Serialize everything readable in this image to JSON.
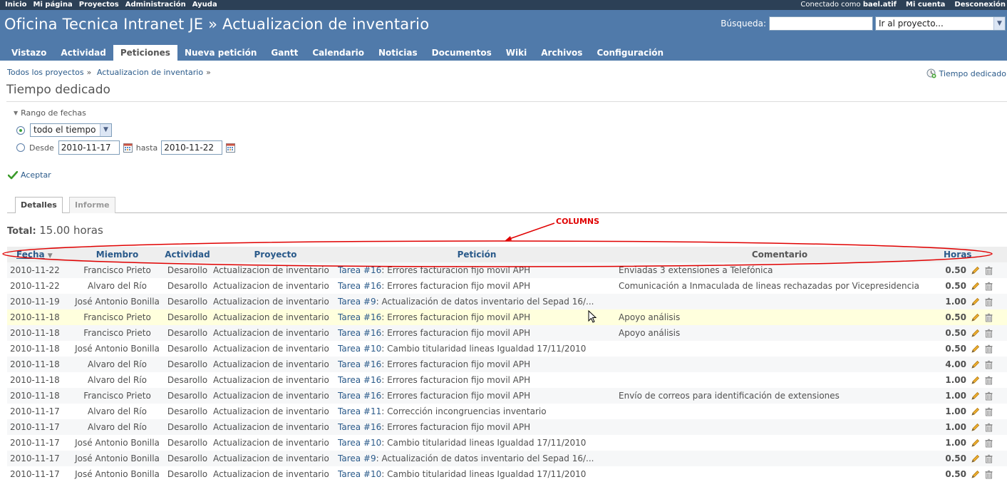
{
  "top_menu": {
    "left": [
      "Inicio",
      "Mi página",
      "Proyectos",
      "Administración",
      "Ayuda"
    ],
    "logged_prefix": "Conectado como",
    "logged_user": "bael.atif",
    "my_account": "Mi cuenta",
    "logout": "Desconexión"
  },
  "header": {
    "title": "Oficina Tecnica Intranet JE » Actualizacion de inventario",
    "search_label": "Búsqueda:",
    "search_value": "",
    "project_jump": "Ir al proyecto..."
  },
  "main_menu": [
    "Vistazo",
    "Actividad",
    "Peticiones",
    "Nueva petición",
    "Gantt",
    "Calendario",
    "Noticias",
    "Documentos",
    "Wiki",
    "Archivos",
    "Configuración"
  ],
  "main_menu_selected": "Peticiones",
  "breadcrumb": [
    "Todos los proyectos",
    "»",
    "Actualizacion de inventario",
    "»"
  ],
  "context_link": "Tiempo dedicado",
  "page_title": "Tiempo dedicado",
  "filters": {
    "legend": "Rango de fechas",
    "period_value": "todo el tiempo",
    "from_label": "Desde",
    "from_value": "2010-11-17",
    "to_label": "hasta",
    "to_value": "2010-11-22",
    "accept": "Aceptar"
  },
  "tabs": [
    "Detalles",
    "Informe"
  ],
  "total_label": "Total:",
  "total_value": "15.00 horas",
  "annotation": "COLUMNS",
  "columns": {
    "date": "Fecha",
    "member": "Miembro",
    "activity": "Actividad",
    "project": "Proyecto",
    "issue": "Petición",
    "comment": "Comentario",
    "hours": "Horas"
  },
  "rows": [
    {
      "date": "2010-11-22",
      "member": "Francisco Prieto",
      "activity": "Desarollo",
      "project": "Actualizacion de inventario",
      "issue_ref": "Tarea #16",
      "issue_title": ": Errores facturacion fijo movil APH",
      "comment": "Enviadas 3 extensiones a Telefónica",
      "hours": "0.50"
    },
    {
      "date": "2010-11-22",
      "member": "Alvaro del Río",
      "activity": "Desarollo",
      "project": "Actualizacion de inventario",
      "issue_ref": "Tarea #16",
      "issue_title": ": Errores facturacion fijo movil APH",
      "comment": "Comunicación a Inmaculada de lineas rechazadas por Vicepresidencia",
      "hours": "0.50"
    },
    {
      "date": "2010-11-19",
      "member": "José Antonio Bonilla",
      "activity": "Desarollo",
      "project": "Actualizacion de inventario",
      "issue_ref": "Tarea #9",
      "issue_title": ": Actualización de datos inventario del Sepad 16/...",
      "comment": "",
      "hours": "1.00"
    },
    {
      "date": "2010-11-18",
      "member": "Francisco Prieto",
      "activity": "Desarollo",
      "project": "Actualizacion de inventario",
      "issue_ref": "Tarea #16",
      "issue_title": ": Errores facturacion fijo movil APH",
      "comment": "Apoyo análisis",
      "hours": "0.50"
    },
    {
      "date": "2010-11-18",
      "member": "Francisco Prieto",
      "activity": "Desarollo",
      "project": "Actualizacion de inventario",
      "issue_ref": "Tarea #16",
      "issue_title": ": Errores facturacion fijo movil APH",
      "comment": "Apoyo análisis",
      "hours": "0.50"
    },
    {
      "date": "2010-11-18",
      "member": "José Antonio Bonilla",
      "activity": "Desarollo",
      "project": "Actualizacion de inventario",
      "issue_ref": "Tarea #10",
      "issue_title": ": Cambio titularidad lineas Igualdad 17/11/2010",
      "comment": "",
      "hours": "0.50"
    },
    {
      "date": "2010-11-18",
      "member": "Alvaro del Río",
      "activity": "Desarollo",
      "project": "Actualizacion de inventario",
      "issue_ref": "Tarea #16",
      "issue_title": ": Errores facturacion fijo movil APH",
      "comment": "",
      "hours": "4.00"
    },
    {
      "date": "2010-11-18",
      "member": "Alvaro del Río",
      "activity": "Desarollo",
      "project": "Actualizacion de inventario",
      "issue_ref": "Tarea #16",
      "issue_title": ": Errores facturacion fijo movil APH",
      "comment": "",
      "hours": "1.00"
    },
    {
      "date": "2010-11-18",
      "member": "Francisco Prieto",
      "activity": "Desarollo",
      "project": "Actualizacion de inventario",
      "issue_ref": "Tarea #16",
      "issue_title": ": Errores facturacion fijo movil APH",
      "comment": "Envío de correos para identificación de extensiones",
      "hours": "1.00"
    },
    {
      "date": "2010-11-17",
      "member": "Alvaro del Río",
      "activity": "Desarollo",
      "project": "Actualizacion de inventario",
      "issue_ref": "Tarea #11",
      "issue_title": ": Corrección incongruencias inventario",
      "comment": "",
      "hours": "1.00"
    },
    {
      "date": "2010-11-17",
      "member": "Alvaro del Río",
      "activity": "Desarollo",
      "project": "Actualizacion de inventario",
      "issue_ref": "Tarea #16",
      "issue_title": ": Errores facturacion fijo movil APH",
      "comment": "",
      "hours": "1.00"
    },
    {
      "date": "2010-11-17",
      "member": "José Antonio Bonilla",
      "activity": "Desarollo",
      "project": "Actualizacion de inventario",
      "issue_ref": "Tarea #10",
      "issue_title": ": Cambio titularidad lineas Igualdad 17/11/2010",
      "comment": "",
      "hours": "1.00"
    },
    {
      "date": "2010-11-17",
      "member": "José Antonio Bonilla",
      "activity": "Desarollo",
      "project": "Actualizacion de inventario",
      "issue_ref": "Tarea #9",
      "issue_title": ": Actualización de datos inventario del Sepad 16/...",
      "comment": "",
      "hours": "0.50"
    },
    {
      "date": "2010-11-17",
      "member": "José Antonio Bonilla",
      "activity": "Desarollo",
      "project": "Actualizacion de inventario",
      "issue_ref": "Tarea #10",
      "issue_title": ": Cambio titularidad lineas Igualdad 17/11/2010",
      "comment": "",
      "hours": "0.50"
    }
  ],
  "highlighted_row": 3,
  "colors": {
    "top_menu_bg": "#2c4056",
    "header_bg": "#507aaa",
    "link": "#2a5a8a",
    "annotation": "#e00000",
    "row_highlight": "#ffffdd"
  }
}
